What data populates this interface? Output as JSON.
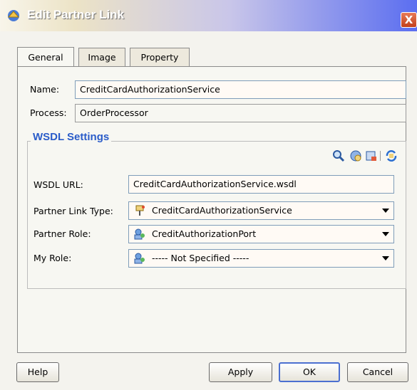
{
  "window": {
    "title": "Edit Partner Link",
    "close_label": "X"
  },
  "tabs": [
    {
      "label": "General"
    },
    {
      "label": "Image"
    },
    {
      "label": "Property"
    }
  ],
  "general": {
    "name_label": "Name:",
    "name_value": "CreditCardAuthorizationService",
    "process_label": "Process:",
    "process_value": "OrderProcessor"
  },
  "wsdl": {
    "group_title": "WSDL Settings",
    "toolbar_icons": [
      "search-icon",
      "browse-services-icon",
      "service-explorer-icon",
      "refresh-icon"
    ],
    "url_label": "WSDL URL:",
    "url_value": "CreditCardAuthorizationService.wsdl",
    "partner_link_type_label": "Partner Link Type:",
    "partner_link_type_value": "CreditCardAuthorizationService",
    "partner_role_label": "Partner Role:",
    "partner_role_value": "CreditAuthorizationPort",
    "my_role_label": "My Role:",
    "my_role_value": "----- Not Specified -----"
  },
  "buttons": {
    "help": "Help",
    "apply": "Apply",
    "ok": "OK",
    "cancel": "Cancel"
  },
  "colors": {
    "group_title": "#2a5cc9",
    "title_gradient_end": "#5b6ef0",
    "close": "#c2401b"
  }
}
